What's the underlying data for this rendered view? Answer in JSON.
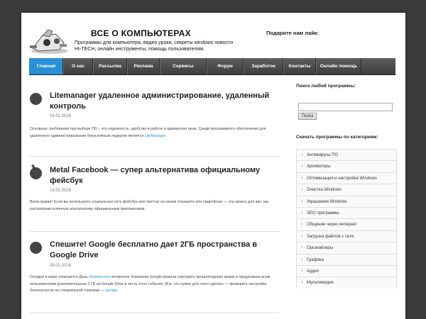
{
  "header": {
    "title": "ВСЕ О КОМПЬЮТЕРАХ",
    "description": "Программы для компьютера, видео уроки, секреты windows новости HI-TECH, онлайн инструменты, помощь пользователям.",
    "share_label": "Подарите нам лайк:"
  },
  "nav": [
    {
      "label": "Главная",
      "active": true
    },
    {
      "label": "О нас"
    },
    {
      "label": "Рассылка"
    },
    {
      "label": "Реклама"
    },
    {
      "label": "Сервисы"
    },
    {
      "label": "Форум"
    },
    {
      "label": "Заработок"
    },
    {
      "label": "Контакты"
    },
    {
      "label": "Онлайн помощь"
    }
  ],
  "posts": [
    {
      "title": "Litemanager удаленное администрирование, удаленный контроль",
      "date": "19.02.2016",
      "excerpt": "Основные требования при выборе ПО – это надежность, удобство в работе и адекватная цена. Среди программного обеспечения для удаленного администрирования безусловным лидером является",
      "link": "LiteManager",
      "after": "."
    },
    {
      "title": "Metal Facebook — супер альтернатива официальному фейсбук",
      "date": "19.02.2016",
      "excerpt": "Всем привет! Если вы используете социальную сеть фейсбук или твиттер на своем планшете или смартфоне — эта запись для вас, мы рассмотрим отличную альтернативу официальным приложениям.",
      "link": "",
      "after": ""
    },
    {
      "title": "Спешите! Google бесплатно дает 2ГБ пространства в Google Drive",
      "date": "09.02.2016",
      "excerpt_pre": "Сегодня в мире отмечается День",
      "excerpt_link1": "безопасного",
      "excerpt_mid": "интернета. Компания Google решила повторить прошлогоднюю акцию и предложила всем пользователям дополнительные 2 ГБ на Google Drive в честь этого события. Все, что нужно для этого сделать — проверить настройки безопасности на специальной странице —",
      "excerpt_link2": "google",
      "after": "."
    }
  ],
  "sidebar": {
    "search_title": "Поиск любой программы:",
    "search_value": "",
    "search_button": "Поиск",
    "categories_title": "Скачать программы по категориям:",
    "categories": [
      "Антивирусы ПО",
      "Архиваторы",
      "Оптимизация и настройка Windows",
      "Очистка Windows",
      "Украшения Windows",
      "SEO программы",
      "Общение через интернет",
      "Загрузка файлов с сети",
      "Органайзеры",
      "Графика",
      "Аудио",
      "Мультимедия"
    ]
  },
  "colors": {
    "accent": "#2a8fd8",
    "nav": "#4a4a4a",
    "background": "#3b3b3b"
  },
  "icons": {
    "post_marker": "dark-circle-icon",
    "category_marker": "chevron-left-icon"
  }
}
